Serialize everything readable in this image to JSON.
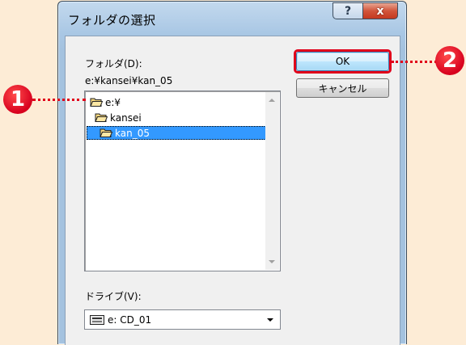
{
  "window": {
    "title": "フォルダの選択",
    "help_label": "?",
    "close_label": "x"
  },
  "folder_label": "フォルダ(D):",
  "current_path": "e:¥kansei¥kan_05",
  "buttons": {
    "ok": "OK",
    "cancel": "キャンセル"
  },
  "tree": [
    {
      "label": "e:¥",
      "icon": "folder-open-icon",
      "selected": false
    },
    {
      "label": "kansei",
      "icon": "folder-open-icon",
      "selected": false
    },
    {
      "label": "kan_05",
      "icon": "folder-open-icon",
      "selected": true
    }
  ],
  "drive_label": "ドライブ(V):",
  "drive_value": "e: CD_01",
  "callouts": {
    "one": "1",
    "two": "2"
  },
  "colors": {
    "accent": "#e0001a",
    "selection": "#3399ff",
    "background": "#fdecd6"
  }
}
